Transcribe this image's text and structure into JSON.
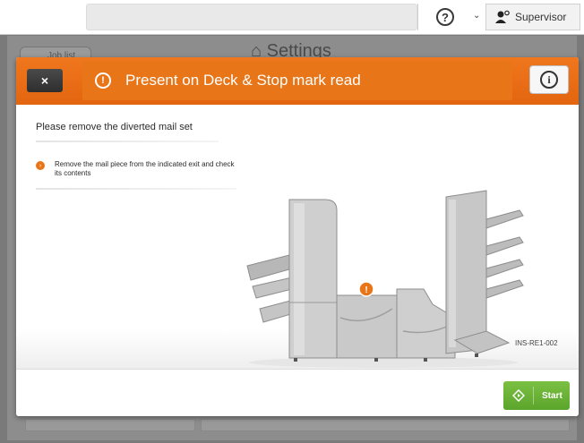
{
  "topbar": {
    "help_icon": "question-circle-icon",
    "user_label": "Supervisor",
    "user_icon": "user-gear-icon"
  },
  "background": {
    "tab_label": "Job list",
    "page_title": "Settings"
  },
  "dialog": {
    "title": "Present on Deck & Stop mark read",
    "close_label": "×",
    "heading": "Please remove the diverted mail set",
    "steps": [
      {
        "marker": "›",
        "text": "Remove the mail piece from the indicated exit and check its contents"
      }
    ],
    "image_code": "INS-RE1-002",
    "start_label": "Start",
    "colors": {
      "accent": "#e87518",
      "start": "#6ab437",
      "close": "#3a3a3a"
    }
  }
}
